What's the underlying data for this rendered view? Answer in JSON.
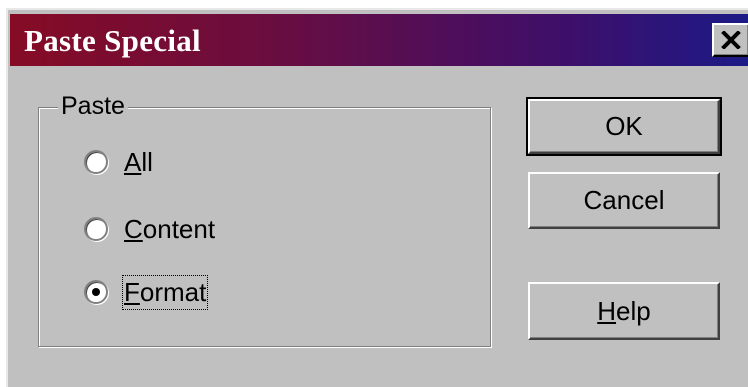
{
  "dialog": {
    "title": "Paste Special",
    "close_icon": "close-icon"
  },
  "paste_group": {
    "label": "Paste",
    "options": [
      {
        "pre": "",
        "key": "A",
        "post": "ll",
        "checked": false
      },
      {
        "pre": "",
        "key": "C",
        "post": "ontent",
        "checked": false
      },
      {
        "pre": "",
        "key": "F",
        "post": "ormat",
        "checked": true
      }
    ]
  },
  "buttons": {
    "ok": "OK",
    "cancel": "Cancel",
    "help_key": "H",
    "help_rest": "elp"
  },
  "colors": {
    "title_gradient_start": "#860c25",
    "title_gradient_end": "#1c1a86",
    "face": "#c0c0c0"
  }
}
